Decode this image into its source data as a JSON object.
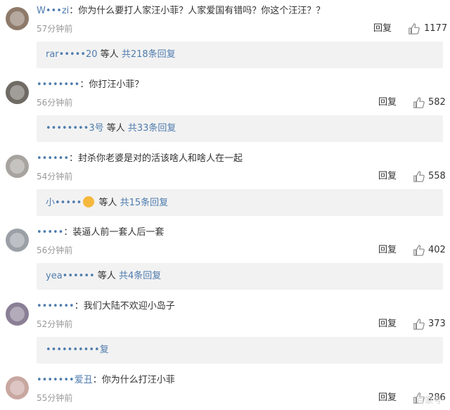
{
  "comments": [
    {
      "user": "W•••zi",
      "text": "：你为什么要打人家汪小菲？人家爱国有错吗？你这个汪汪？？",
      "time": "57分钟前",
      "reply_label": "回复",
      "likes": "1177",
      "sub": {
        "users": "rar•••••20",
        "mid": " 等人 ",
        "link": "共218条回复"
      }
    },
    {
      "user": "••••••••",
      "text": "：你打汪小菲？",
      "time": "56分钟前",
      "reply_label": "回复",
      "likes": "582",
      "sub": {
        "users": "••••••••3号",
        "mid": " 等人 ",
        "link": "共33条回复"
      }
    },
    {
      "user": "••••••",
      "text": "：封杀你老婆是对的活该啥人和啥人在一起",
      "time": "54分钟前",
      "reply_label": "回复",
      "likes": "558",
      "sub": {
        "users": "小•••••",
        "mid": " 等人 ",
        "link": "共15条回复",
        "emoji": true
      }
    },
    {
      "user": "•••••",
      "text": "：装逼人前一套人后一套",
      "time": "56分钟前",
      "reply_label": "回复",
      "likes": "402",
      "sub": {
        "users": "yea••••••",
        "mid": " 等人 ",
        "link": "共4条回复"
      }
    },
    {
      "user": "•••••••",
      "text": "：我们大陆不欢迎小岛子",
      "time": "52分钟前",
      "reply_label": "回复",
      "likes": "373",
      "sub": {
        "users": "••••••••••",
        "mid": "",
        "link": "复"
      }
    },
    {
      "user": "•••••••爱丑",
      "text": "：你为什么打汪小菲",
      "time": "55分钟前",
      "reply_label": "回复",
      "likes": "286"
    }
  ],
  "watermark": "百家号·"
}
